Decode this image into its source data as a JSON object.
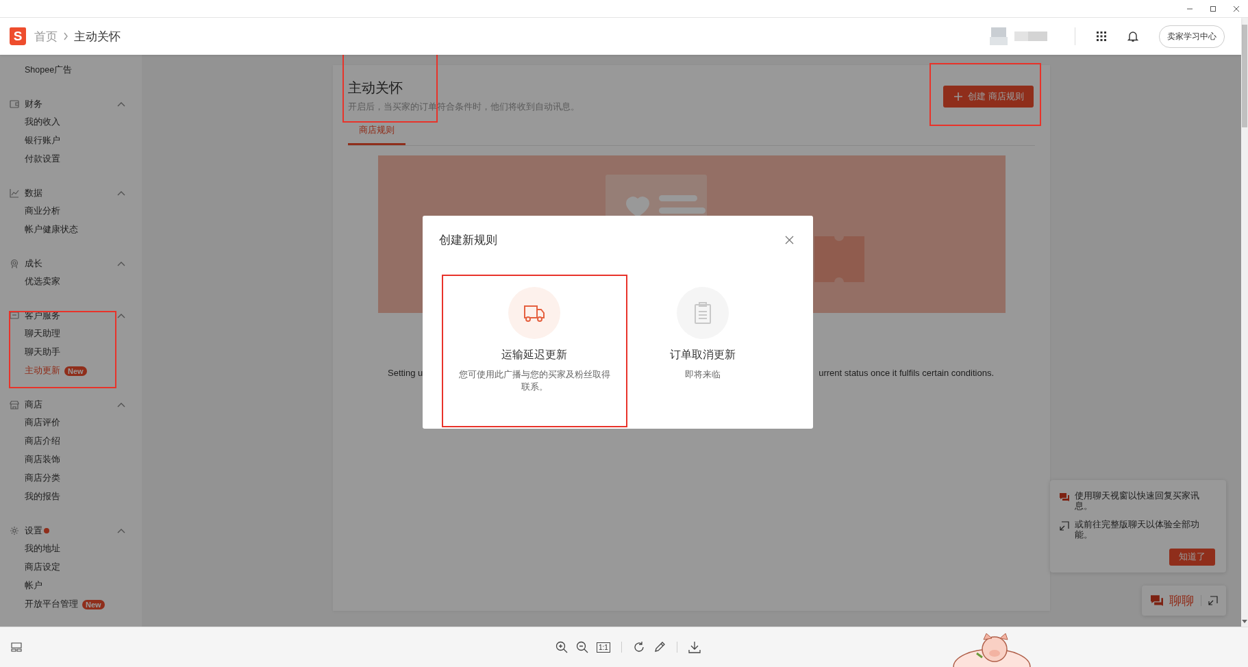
{
  "viewer": {
    "actual_size_label": "1:1"
  },
  "topbar": {
    "logo": "S",
    "breadcrumb": [
      "首页",
      "主动关怀"
    ],
    "learning_button": "卖家学习中心"
  },
  "sidebar": {
    "sections": [
      {
        "items": [
          {
            "label": "Shopee广告",
            "selected": false
          }
        ]
      },
      {
        "title": "财务",
        "expanded": true,
        "items": [
          {
            "label": "我的收入",
            "selected": false
          },
          {
            "label": "银行账户",
            "selected": false
          },
          {
            "label": "付款设置",
            "selected": false
          }
        ]
      },
      {
        "title": "数据",
        "expanded": true,
        "items": [
          {
            "label": "商业分析",
            "selected": false
          },
          {
            "label": "帐户健康状态",
            "selected": false
          }
        ]
      },
      {
        "title": "成长",
        "expanded": true,
        "items": [
          {
            "label": "优选卖家",
            "selected": false
          }
        ]
      },
      {
        "title": "客户服务",
        "expanded": true,
        "items": [
          {
            "label": "聊天助理",
            "selected": false
          },
          {
            "label": "聊天助手",
            "selected": false
          },
          {
            "label": "主动更新",
            "selected": true,
            "badge": "New"
          }
        ]
      },
      {
        "title": "商店",
        "expanded": true,
        "items": [
          {
            "label": "商店评价",
            "selected": false
          },
          {
            "label": "商店介绍",
            "selected": false
          },
          {
            "label": "商店装饰",
            "selected": false
          },
          {
            "label": "商店分类",
            "selected": false
          },
          {
            "label": "我的报告",
            "selected": false
          }
        ]
      },
      {
        "title": "设置",
        "expanded": true,
        "alert": true,
        "items": [
          {
            "label": "我的地址",
            "selected": false
          },
          {
            "label": "商店设定",
            "selected": false
          },
          {
            "label": "帐户",
            "selected": false
          },
          {
            "label": "开放平台管理",
            "selected": false,
            "badge": "New"
          }
        ]
      }
    ]
  },
  "page": {
    "title": "主动关怀",
    "subtitle": "开启后，当买家的订单符合条件时，他们将收到自动讯息。",
    "create_button": "创建 商店规则",
    "tabs": [
      {
        "label": "商店规则",
        "selected": true
      }
    ],
    "description_fragments": [
      "Setting u",
      "urrent status once it fulfils certain conditions."
    ]
  },
  "modal": {
    "title": "创建新规则",
    "options": [
      {
        "title": "运输延迟更新",
        "description": "您可使用此广播与您的买家及粉丝取得联系。",
        "disabled": false
      },
      {
        "title": "订单取消更新",
        "description": "即将来临",
        "disabled": true
      }
    ]
  },
  "chat_tip": {
    "lines": [
      "使用聊天视窗以快速回复买家讯息。",
      "或前往完整版聊天以体验全部功能。"
    ],
    "button": "知道了"
  },
  "chat_button": {
    "label": "聊聊"
  }
}
